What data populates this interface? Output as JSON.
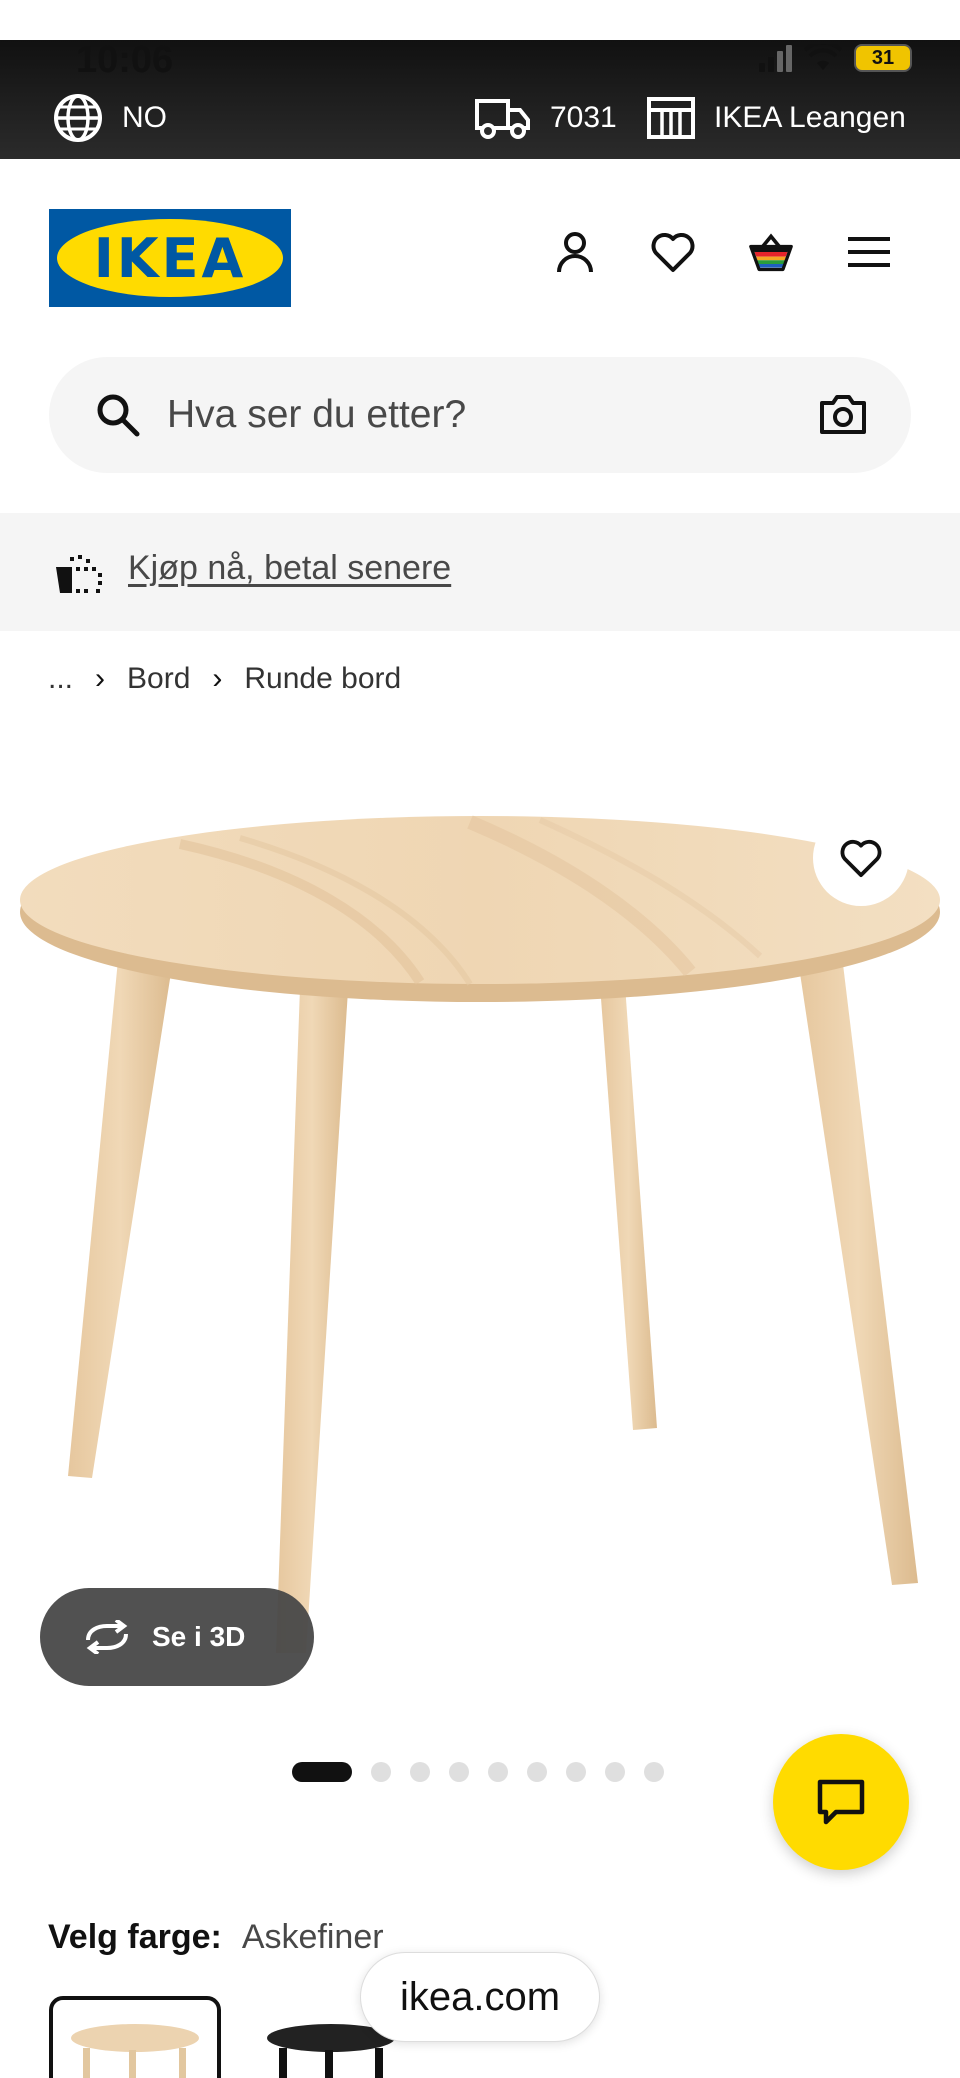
{
  "status": {
    "time": "10:06",
    "battery": "31"
  },
  "location_bar": {
    "country": "NO",
    "postal_code": "7031",
    "store": "IKEA Leangen"
  },
  "header": {
    "logo_text": "IKEA",
    "icons": [
      "user-icon",
      "heart-icon",
      "basket-icon",
      "menu-icon"
    ]
  },
  "search": {
    "placeholder": "Hva ser du etter?"
  },
  "promo": {
    "link": "Kjøp nå, betal senere"
  },
  "breadcrumb": {
    "ellipsis": "...",
    "items": [
      "Bord",
      "Runde bord"
    ]
  },
  "product": {
    "view_3d_label": "Se i 3D",
    "image_count": 9,
    "active_image": 1
  },
  "color": {
    "label": "Velg farge:",
    "value": "Askefiner"
  },
  "browser": {
    "url": "ikea.com"
  },
  "colors": {
    "brand_blue": "#0058a3",
    "brand_yellow": "#ffdb00",
    "wood": "#ecd3b0"
  }
}
